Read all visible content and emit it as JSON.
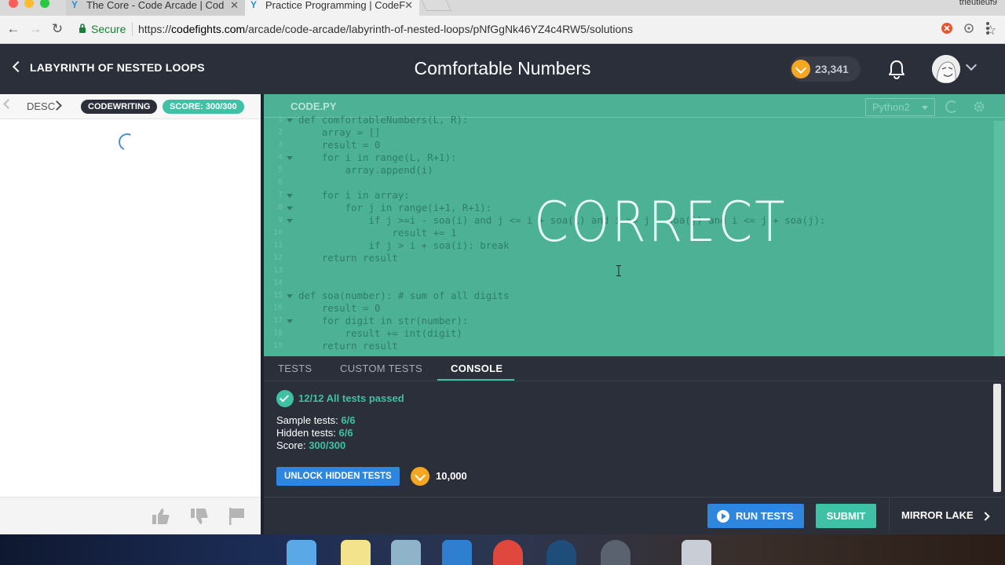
{
  "browser": {
    "tabs": [
      {
        "title": "The Core - Code Arcade | Cod",
        "active": false
      },
      {
        "title": "Practice Programming | CodeF",
        "active": true
      }
    ],
    "profile_name": "trieutieuf9",
    "secure_label": "Secure",
    "url_prefix": "https://",
    "url_host": "codefights.com",
    "url_path": "/arcade/code-arcade/labyrinth-of-nested-loops/pNfGgNk46YZ4c4RW5/solutions"
  },
  "header": {
    "back_label": "LABYRINTH OF NESTED LOOPS",
    "title": "Comfortable Numbers",
    "coins": "23,341"
  },
  "left": {
    "desc_tab": "DESC",
    "badge_mode": "CODEWRITING",
    "badge_score": "SCORE: 300/300"
  },
  "editor": {
    "file_tab": "CODE.PY",
    "language": "Python2",
    "overlay": "CORRECT",
    "code_lines": [
      "def comfortableNumbers(L, R):",
      "    array = []",
      "    result = 0",
      "    for i in range(L, R+1):",
      "        array.append(i)",
      "",
      "    for i in array:",
      "        for j in range(i+1, R+1):",
      "            if j >=i - soa(i) and j <= i + soa(i) and i >= j - soa(j) and i <= j + soa(j):",
      "                result += 1",
      "            if j > i + soa(i): break",
      "    return result",
      "",
      "",
      "def soa(number): # sum of all digits",
      "    result = 0",
      "    for digit in str(number):",
      "        result += int(digit)",
      "    return result"
    ],
    "line_numbers": [
      "1",
      "2",
      "3",
      "4",
      "5",
      "6",
      "7",
      "8",
      "9",
      "10",
      "11",
      "12",
      "13",
      "14",
      "15",
      "16",
      "17",
      "18",
      "19"
    ]
  },
  "bottom_tabs": {
    "tests": "TESTS",
    "custom_tests": "CUSTOM TESTS",
    "console": "CONSOLE"
  },
  "console": {
    "summary": "12/12 All tests passed",
    "sample_label": "Sample tests: ",
    "sample_value": "6/6",
    "hidden_label": "Hidden tests: ",
    "hidden_value": "6/6",
    "score_label": "Score: ",
    "score_value": "300/300",
    "unlock_label": "UNLOCK HIDDEN TESTS",
    "unlock_cost": "10,000"
  },
  "actions": {
    "run_label": "RUN TESTS",
    "submit_label": "SUBMIT",
    "next_task": "MIRROR LAKE"
  },
  "colors": {
    "editor_bg": "#4cb195",
    "accent_green": "#3fc1a5",
    "accent_blue": "#2e86de",
    "header_bg": "#2b2f3a",
    "coin": "#f5a623"
  }
}
